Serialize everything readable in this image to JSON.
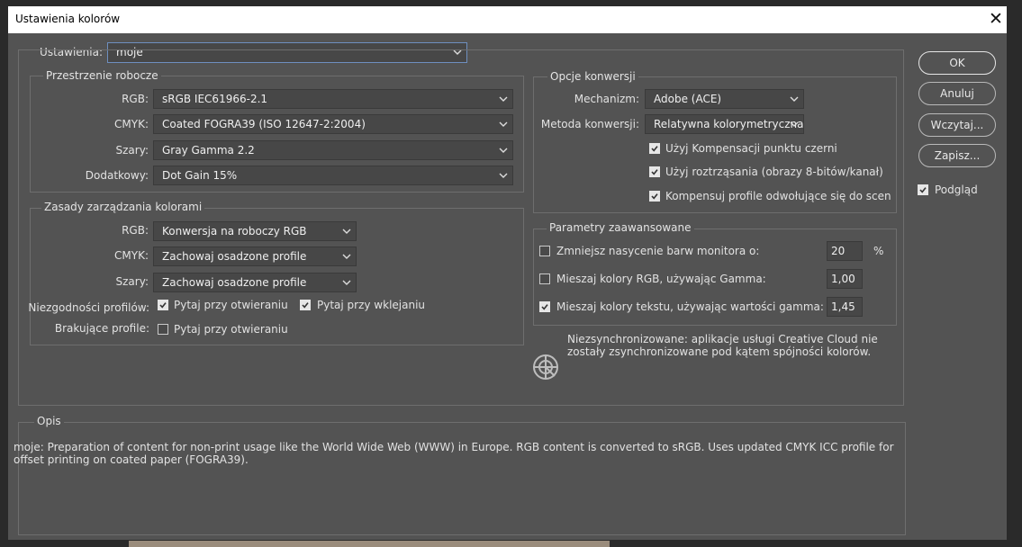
{
  "window": {
    "title": "Ustawienia kolorów",
    "close_glyph": "✕"
  },
  "settings": {
    "label": "Ustawienia:",
    "value": "moje"
  },
  "working_spaces": {
    "title": "Przestrzenie robocze",
    "rows": [
      {
        "label": "RGB:",
        "value": "sRGB IEC61966-2.1"
      },
      {
        "label": "CMYK:",
        "value": "Coated FOGRA39 (ISO 12647-2:2004)"
      },
      {
        "label": "Szary:",
        "value": "Gray Gamma 2.2"
      },
      {
        "label": "Dodatkowy:",
        "value": "Dot Gain 15%"
      }
    ]
  },
  "policies": {
    "title": "Zasady zarządzania kolorami",
    "rows": [
      {
        "label": "RGB:",
        "value": "Konwersja na roboczy RGB"
      },
      {
        "label": "CMYK:",
        "value": "Zachowaj osadzone profile"
      },
      {
        "label": "Szary:",
        "value": "Zachowaj osadzone profile"
      }
    ],
    "mismatch": {
      "label": "Niezgodności profilów:",
      "open": {
        "label": "Pytaj przy otwieraniu",
        "checked": true
      },
      "paste": {
        "label": "Pytaj przy wklejaniu",
        "checked": true
      }
    },
    "missing": {
      "label": "Brakujące profile:",
      "open": {
        "label": "Pytaj przy otwieraniu",
        "checked": false
      }
    }
  },
  "conversion": {
    "title": "Opcje konwersji",
    "engine": {
      "label": "Mechanizm:",
      "value": "Adobe (ACE)"
    },
    "intent": {
      "label": "Metoda konwersji:",
      "value": "Relatywna kolorymetryczna"
    },
    "options": [
      {
        "label": "Użyj Kompensacji punktu czerni",
        "checked": true
      },
      {
        "label": "Użyj roztrząsania (obrazy 8-bitów/kanał)",
        "checked": true
      },
      {
        "label": "Kompensuj profile odwołujące się do scen",
        "checked": true
      }
    ]
  },
  "advanced": {
    "title": "Parametry zaawansowane",
    "rows": [
      {
        "label": "Zmniejsz nasycenie barw monitora o:",
        "value": "20",
        "unit": "%",
        "checked": false
      },
      {
        "label": "Mieszaj kolory RGB, używając Gamma:",
        "value": "1,00",
        "checked": false
      },
      {
        "label": "Mieszaj kolory tekstu, używając wartości gamma:",
        "value": "1,45",
        "checked": true
      }
    ]
  },
  "sync_message": "Niezsynchronizowane: aplikacje usługi Creative Cloud nie zostały zsynchronizowane pod kątem spójności kolorów.",
  "sync_icon": "creative-cloud-sync-icon",
  "description": {
    "title": "Opis",
    "text": "moje:  Preparation of content for non-print usage like the World Wide Web (WWW) in Europe. RGB content is converted to sRGB. Uses updated CMYK ICC profile for offset printing on coated paper (FOGRA39)."
  },
  "buttons": {
    "ok": "OK",
    "cancel": "Anuluj",
    "load": "Wczytaj...",
    "save": "Zapisz..."
  },
  "preview": {
    "label": "Podgląd",
    "checked": true
  },
  "colors": {
    "dialog_bg": "#535353",
    "field_bg": "#474747",
    "text": "#e2e2e2",
    "title_bar": "#ffffff"
  }
}
